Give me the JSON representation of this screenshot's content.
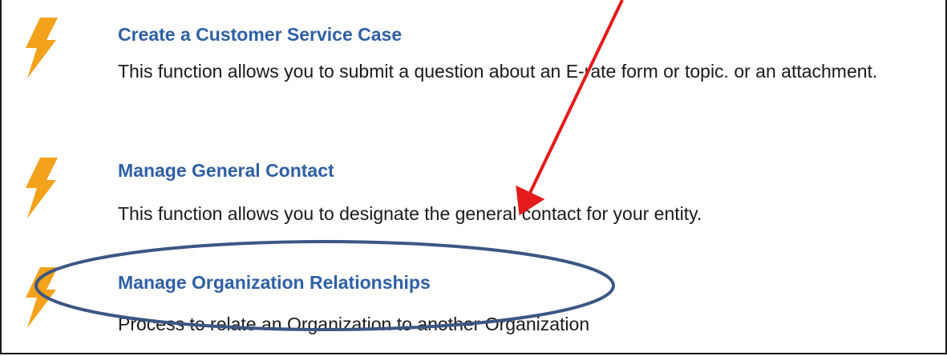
{
  "items": [
    {
      "title": "Create a Customer Service Case",
      "description": "This function allows you to submit a question about an E-rate form or topic. or an attachment.",
      "icon": "lightning-bolt-icon"
    },
    {
      "title": "Manage General Contact",
      "description": "This function allows you to designate the general contact for your entity.",
      "icon": "lightning-bolt-icon"
    },
    {
      "title": "Manage Organization Relationships",
      "description": "Process to relate an Organization to another Organization",
      "icon": "lightning-bolt-icon"
    }
  ],
  "colors": {
    "link": "#2f5fa5",
    "bolt": "#f3a21c",
    "annotation_arrow": "#e31b1b",
    "annotation_ellipse": "#3b5783"
  }
}
